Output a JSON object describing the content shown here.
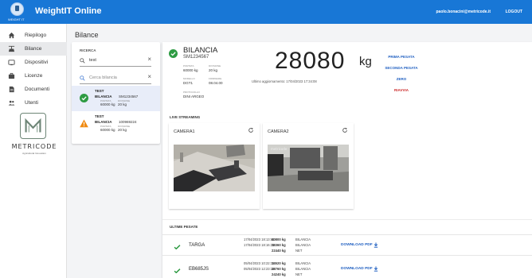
{
  "header": {
    "logo_caption": "WEIGHT IT",
    "app_title": "WeightIT Online",
    "user_email": "paolo.bonacini@metricode.it",
    "logout_label": "LOGOUT"
  },
  "sidebar": {
    "items": [
      {
        "label": "Riepilogo",
        "icon": "home-icon",
        "active": false
      },
      {
        "label": "Bilance",
        "icon": "scale-icon",
        "active": true
      },
      {
        "label": "Dispositivi",
        "icon": "device-icon",
        "active": false
      },
      {
        "label": "Licenze",
        "icon": "license-icon",
        "active": false
      },
      {
        "label": "Documenti",
        "icon": "document-icon",
        "active": false
      },
      {
        "label": "Utenti",
        "icon": "users-icon",
        "active": false
      }
    ],
    "brand_name": "METRICODE",
    "brand_tagline": "Agricultural Innovation",
    "brand_color": "#6e8677"
  },
  "main": {
    "title": "Bilance"
  },
  "search": {
    "label": "RICERCA",
    "query": "test",
    "filter_placeholder": "Cerca bilancia",
    "results": [
      {
        "name": "TEST",
        "type": "BILANCIA",
        "serial": "SM1234567",
        "portata_label": "PORTATA",
        "divisione_label": "DIVISIONE",
        "portata": "60000 kg",
        "divisione": "20 kg",
        "status": "ok"
      },
      {
        "name": "TEST",
        "type": "BILANCIA",
        "serial": "100969224",
        "portata_label": "PORTATA",
        "divisione_label": "DIVISIONE",
        "portata": "60000 kg",
        "divisione": "20 kg",
        "status": "warning"
      }
    ]
  },
  "detail": {
    "name": "BILANCIA",
    "serial": "SM1234567",
    "portata_label": "PORTATA",
    "portata": "60000 kg",
    "divisione_label": "DIVISIONE",
    "divisione": "20 kg",
    "modello_label": "MODELLO",
    "modello": "DGT1",
    "firmware_label": "FIRMWARE",
    "firmware": "08.04.00",
    "protocollo_label": "PROTOCOLLO",
    "protocollo": "DINI ARGEO",
    "weight": "28080",
    "unit": "kg",
    "last_update": "Ultimo aggiornamento: 17/04/2023 17:34:08",
    "actions": {
      "prima": "PRIMA PESATA",
      "seconda": "SECONDA PESATA",
      "zero": "ZERO",
      "riavvia": "RIAVVIA"
    },
    "live_title": "LIVE STREAMING",
    "cameras": [
      {
        "name": "CAMERA1",
        "overlay": ""
      },
      {
        "name": "CAMERA2",
        "overlay": "metricode"
      }
    ],
    "history_title": "ULTIME PESATE",
    "download_label": "DOWNLOAD PDF",
    "history": [
      {
        "plate": "TARGA",
        "date1": "17/04/2023 18:13:55",
        "date2": "17/04/2023 18:16:21",
        "w1": "40800 kg",
        "w2": "18360 kg",
        "w3": "22440 kg",
        "l1": "BILANCIA",
        "l2": "BILANCIA",
        "l3": "NET"
      },
      {
        "plate": "EB685JS",
        "date1": "05/04/2023 10:22:13",
        "date2": "05/04/2023 12:23:13",
        "w1": "14520 kg",
        "w2": "38760 kg",
        "w3": "24240 kg",
        "l1": "BILANCIA",
        "l2": "BILANCIA",
        "l3": "NET"
      }
    ]
  },
  "colors": {
    "primary": "#1877d6",
    "ok": "#2e9b43",
    "warning": "#f08a12",
    "link": "#1f5fc1",
    "danger": "#cc2b2b"
  }
}
